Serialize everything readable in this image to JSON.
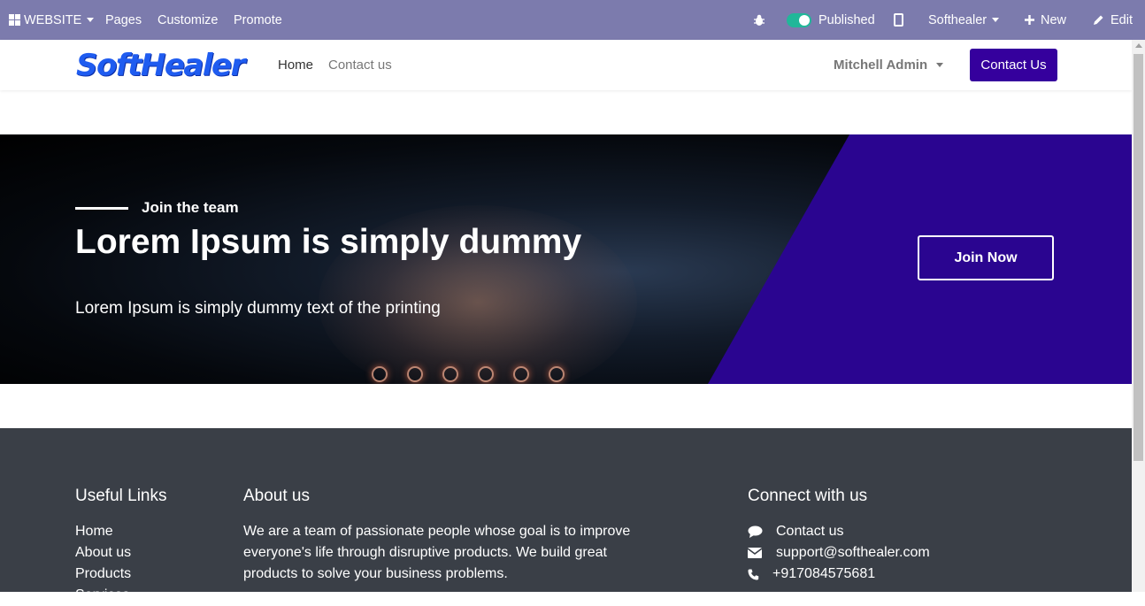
{
  "editor_bar": {
    "website_menu": "WEBSITE",
    "pages": "Pages",
    "customize": "Customize",
    "promote": "Promote",
    "published_label": "Published",
    "company": "Softhealer",
    "new_label": "New",
    "edit_label": "Edit",
    "bg_color": "#7c7bad",
    "toggle_color": "#21b799"
  },
  "header": {
    "logo_text": "SoftHealer",
    "nav": [
      {
        "label": "Home"
      },
      {
        "label": "Contact us"
      }
    ],
    "user": "Mitchell Admin",
    "cta": "Contact Us",
    "cta_color": "#35009d"
  },
  "hero": {
    "tag": "Join the team",
    "title": "Lorem Ipsum is simply dummy",
    "subtitle": "Lorem Ipsum is simply dummy text of the printing",
    "button": "Join Now",
    "accent_color": "#2a0590"
  },
  "footer": {
    "useful_links_title": "Useful Links",
    "links": [
      {
        "label": "Home"
      },
      {
        "label": "About us"
      },
      {
        "label": "Products"
      },
      {
        "label": "Services"
      }
    ],
    "about_title": "About us",
    "about_text": "We are a team of passionate people whose goal is to improve everyone's life through disruptive products. We build great products to solve your business problems.",
    "connect_title": "Connect with us",
    "contact_label": "Contact us",
    "email": "support@softhealer.com",
    "phone": "+917084575681",
    "bg_color": "#3a3f47"
  },
  "icons": [
    "apps-grid-icon",
    "bug-icon",
    "publish-toggle",
    "mobile-preview-icon",
    "plus-icon",
    "pencil-icon",
    "chat-bubble-icon",
    "envelope-icon",
    "phone-icon"
  ]
}
